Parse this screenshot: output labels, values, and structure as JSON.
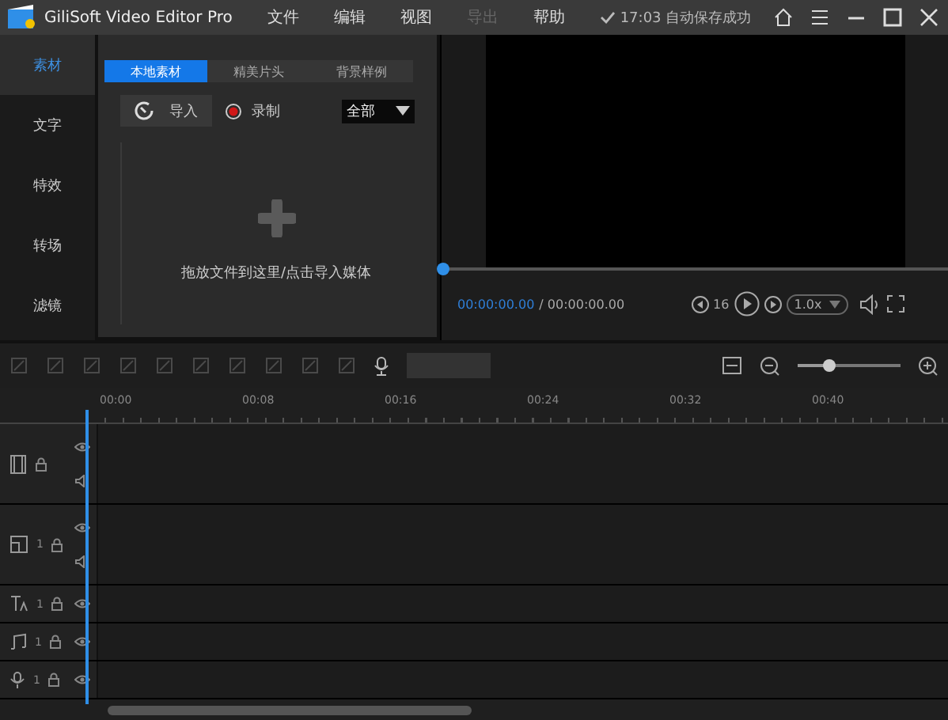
{
  "window": {
    "title": "GiliSoft Video Editor Pro",
    "status": "17:03 自动保存成功"
  },
  "menu": [
    {
      "label": "文件",
      "disabled": false
    },
    {
      "label": "编辑",
      "disabled": false
    },
    {
      "label": "视图",
      "disabled": false
    },
    {
      "label": "导出",
      "disabled": true
    },
    {
      "label": "帮助",
      "disabled": false
    }
  ],
  "sidebar": [
    {
      "label": "素材",
      "selected": true
    },
    {
      "label": "文字",
      "selected": false
    },
    {
      "label": "特效",
      "selected": false
    },
    {
      "label": "转场",
      "selected": false
    },
    {
      "label": "滤镜",
      "selected": false
    }
  ],
  "tabs": [
    {
      "label": "本地素材",
      "selected": true
    },
    {
      "label": "精美片头",
      "selected": false
    },
    {
      "label": "背景样例",
      "selected": false
    }
  ],
  "import_button": "导入",
  "record_button": "录制",
  "filter": "全部",
  "drop_hint": "拖放文件到这里/点击导入媒体",
  "player": {
    "current": "00:00:00.00",
    "total": "/ 00:00:00.00",
    "step": "16",
    "speed": "1.0x"
  },
  "zoom_slider": {
    "level": 0.3
  },
  "ruler": [
    "00:00",
    "00:08",
    "00:16",
    "00:24",
    "00:32",
    "00:40"
  ],
  "tracks": [
    {
      "kind": "video"
    },
    {
      "kind": "overlay",
      "number": "1"
    },
    {
      "kind": "text",
      "number": "1"
    },
    {
      "kind": "music",
      "number": "1"
    },
    {
      "kind": "voice",
      "number": "1"
    }
  ]
}
